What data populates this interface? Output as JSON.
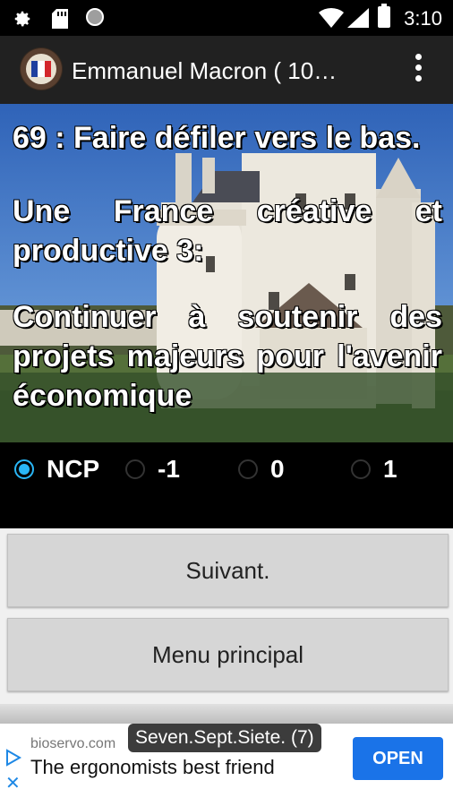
{
  "status_bar": {
    "time": "3:10",
    "icons": [
      "gear-icon",
      "sd-card-icon",
      "circle-icon",
      "wifi-icon",
      "signal-icon",
      "battery-icon"
    ]
  },
  "app_bar": {
    "title": "Emmanuel Macron ( 10…",
    "logo": "french-flag-emblem",
    "menu_icon": "overflow-menu-icon"
  },
  "question": {
    "title": "69 : Faire défiler vers le bas.",
    "section": "Une France créative et productive 3:",
    "body": "Continuer à soutenir des projets majeurs pour l'avenir économique"
  },
  "options": {
    "selected": "NCP",
    "items": [
      "NCP",
      "-1",
      "0",
      "1"
    ]
  },
  "buttons": {
    "next": "Suivant.",
    "main_menu": "Menu principal"
  },
  "ad": {
    "domain": "bioservo.com",
    "headline": "The ergonomists best friend",
    "cta": "OPEN"
  },
  "toast": "Seven.Sept.Siete. (7)",
  "colors": {
    "accent": "#29b6f6",
    "ad_button": "#1a73e8",
    "app_bar": "#212121"
  }
}
